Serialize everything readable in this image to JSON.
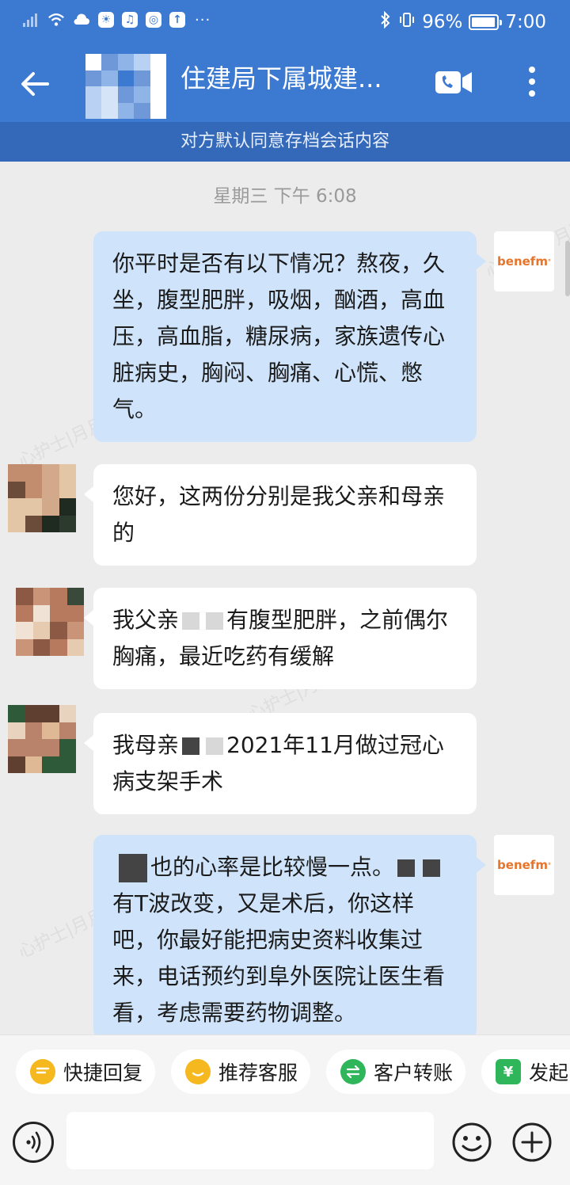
{
  "status_bar": {
    "battery_percent": "96%",
    "battery_level": 0.96,
    "time": "7:00",
    "more_indicator": "···"
  },
  "header": {
    "title": "住建局下属城建...",
    "notice": "对方默认同意存档会话内容"
  },
  "chat": {
    "timestamp": "星期三  下午 6:08",
    "sender_logo_text": "benefm",
    "messages": [
      {
        "direction": "out",
        "text": "你平时是否有以下情况？熬夜，久坐，腹型肥胖，吸烟，酗酒，高血压，高血脂，糖尿病，家族遗传心脏病史，胸闷、胸痛、心慌、憋气。"
      },
      {
        "direction": "in",
        "text": "您好，这两份分别是我父亲和母亲的"
      },
      {
        "direction": "in",
        "text_before": "我父亲",
        "text_after": "有腹型肥胖，之前偶尔胸痛，最近吃药有缓解"
      },
      {
        "direction": "in",
        "text_before": "我母亲",
        "text_after": "2021年11月做过冠心病支架手术"
      },
      {
        "direction": "out",
        "text_part1": "也的心率是比较慢一点。",
        "text_part2": "有T波改变，又是术后，你这样吧，你最好能把病史资料收集过来，电话预约到阜外医院让医生看看，考虑需要药物调整。"
      }
    ]
  },
  "quick_actions": [
    {
      "label": "快捷回复",
      "icon": "quick-reply-icon",
      "color": "#f5b81f"
    },
    {
      "label": "推荐客服",
      "icon": "recommend-service-icon",
      "color": "#f5b81f"
    },
    {
      "label": "客户转账",
      "icon": "transfer-icon",
      "color": "#2fb55a"
    },
    {
      "label": "发起",
      "icon": "shield-icon",
      "color": "#2fb55a"
    }
  ],
  "input": {
    "value": "",
    "placeholder": ""
  },
  "colors": {
    "primary": "#3c7ad2",
    "bubble_out": "#cfe4fb",
    "bubble_in": "#ffffff",
    "logo": "#e7742b"
  }
}
